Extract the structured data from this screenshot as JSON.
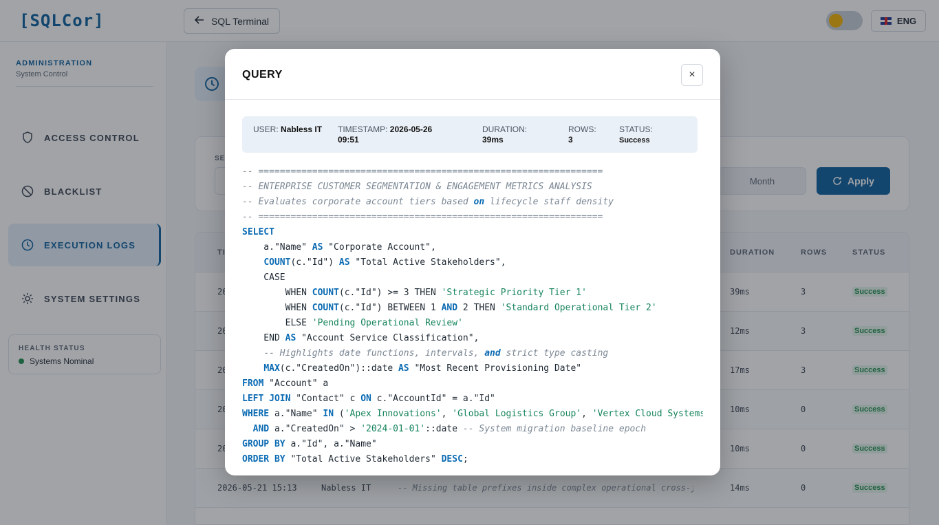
{
  "app": {
    "logo": "[SQLCor]",
    "back_label": "SQL Terminal",
    "lang": "ENG"
  },
  "sidebar": {
    "title": "ADMINISTRATION",
    "subtitle": "System Control",
    "items": [
      {
        "label": "ACCESS CONTROL",
        "icon": "shield-icon"
      },
      {
        "label": "BLACKLIST",
        "icon": "ban-icon"
      },
      {
        "label": "EXECUTION LOGS",
        "icon": "clock-icon",
        "active": true
      },
      {
        "label": "SYSTEM SETTINGS",
        "icon": "gear-icon"
      }
    ],
    "health_title": "HEALTH STATUS",
    "health_value": "Systems Nominal"
  },
  "filters": {
    "label": "SE",
    "segment": "Month",
    "apply_label": "Apply"
  },
  "table": {
    "headers": {
      "first": "TI",
      "duration": "DURATION",
      "rows": "ROWS",
      "status": "STATUS"
    },
    "rows": [
      {
        "time": "20",
        "duration": "39ms",
        "rows": "3",
        "status": "Success"
      },
      {
        "time": "20",
        "duration": "12ms",
        "rows": "3",
        "status": "Success"
      },
      {
        "time": "20",
        "duration": "17ms",
        "rows": "3",
        "status": "Success"
      },
      {
        "time": "20",
        "duration": "10ms",
        "rows": "0",
        "status": "Success"
      },
      {
        "time": "20",
        "duration": "10ms",
        "rows": "0",
        "status": "Success"
      },
      {
        "time": "2026-05-21 15:13",
        "user": "Nabless IT",
        "query": "-- Missing table prefixes inside complex operational cross-j",
        "duration": "14ms",
        "rows": "0",
        "status": "Success"
      }
    ]
  },
  "modal": {
    "title": "QUERY",
    "close": "×",
    "meta": {
      "user_label": "USER:",
      "user_value": "Nabless IT",
      "timestamp_label": "TIMESTAMP:",
      "timestamp_value": "2026-05-26 09:51",
      "duration_label": "DURATION:",
      "duration_value": "39ms",
      "rows_label": "ROWS:",
      "rows_value": "3",
      "status_label": "STATUS:",
      "status_value": "Success"
    },
    "sql_lines": [
      "-- ================================================================",
      "-- ENTERPRISE CUSTOMER SEGMENTATION & ENGAGEMENT METRICS ANALYSIS",
      "-- Evaluates corporate account tiers based on lifecycle staff density",
      "-- ================================================================",
      "SELECT",
      "    a.\"Name\" AS \"Corporate Account\",",
      "    COUNT(c.\"Id\") AS \"Total Active Stakeholders\",",
      "    CASE",
      "        WHEN COUNT(c.\"Id\") >= 3 THEN 'Strategic Priority Tier 1'",
      "        WHEN COUNT(c.\"Id\") BETWEEN 1 AND 2 THEN 'Standard Operational Tier 2'",
      "        ELSE 'Pending Operational Review'",
      "    END AS \"Account Service Classification\",",
      "    -- Highlights date functions, intervals, and strict type casting",
      "    MAX(c.\"CreatedOn\")::date AS \"Most Recent Provisioning Date\"",
      "FROM \"Account\" a",
      "LEFT JOIN \"Contact\" c ON c.\"AccountId\" = a.\"Id\"",
      "WHERE a.\"Name\" IN ('Apex Innovations', 'Global Logistics Group', 'Vertex Cloud Systems')",
      "  AND a.\"CreatedOn\" > '2024-01-01'::date -- System migration baseline epoch",
      "GROUP BY a.\"Id\", a.\"Name\"",
      "ORDER BY \"Total Active Stakeholders\" DESC;"
    ]
  }
}
